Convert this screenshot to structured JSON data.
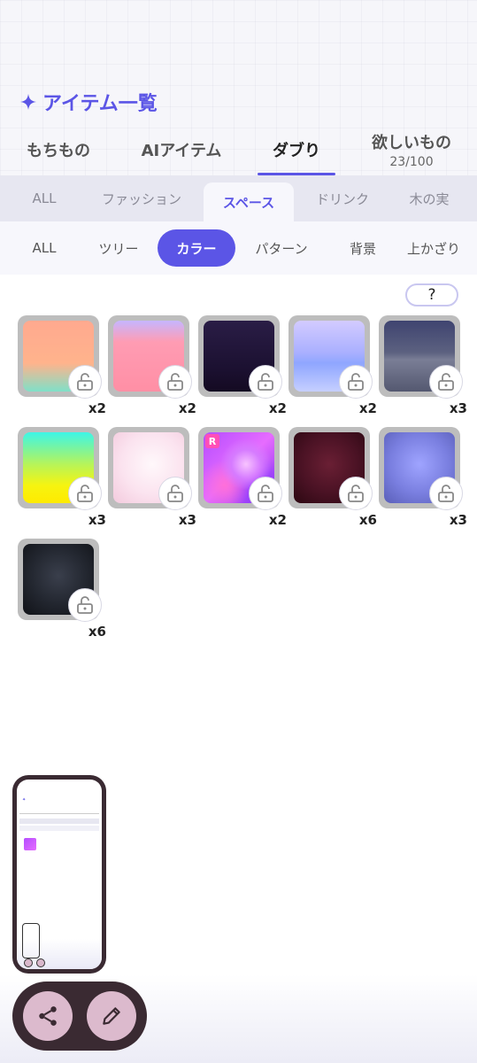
{
  "title": {
    "icon": "sparkle-icon",
    "text": "アイテム一覧"
  },
  "main_tabs": [
    {
      "label": "もちもの",
      "sub": ""
    },
    {
      "label": "AIアイテム",
      "sub": ""
    },
    {
      "label": "ダブり",
      "sub": ""
    },
    {
      "label": "欲しいもの",
      "sub": "23/100"
    }
  ],
  "main_tabs_active": "ダブり",
  "categories": [
    "ALL",
    "ファッション",
    "スペース",
    "ドリンク",
    "木の実"
  ],
  "categories_active": "スペース",
  "subcategories": [
    "ALL",
    "ツリー",
    "カラー",
    "パターン",
    "背景",
    "上かざり"
  ],
  "subcategories_active": "カラー",
  "help": {
    "label": "?"
  },
  "items": [
    {
      "count": "x2",
      "locked": true,
      "rare": ""
    },
    {
      "count": "x2",
      "locked": true,
      "rare": ""
    },
    {
      "count": "x2",
      "locked": true,
      "rare": ""
    },
    {
      "count": "x2",
      "locked": true,
      "rare": ""
    },
    {
      "count": "x3",
      "locked": true,
      "rare": ""
    },
    {
      "count": "x3",
      "locked": true,
      "rare": ""
    },
    {
      "count": "x3",
      "locked": true,
      "rare": ""
    },
    {
      "count": "x2",
      "locked": true,
      "rare": "R"
    },
    {
      "count": "x6",
      "locked": true,
      "rare": ""
    },
    {
      "count": "x3",
      "locked": true,
      "rare": ""
    },
    {
      "count": "x6",
      "locked": true,
      "rare": ""
    }
  ],
  "actions": {
    "share_icon": "share-icon",
    "edit_icon": "pencil-icon"
  },
  "colors": {
    "accent": "#5b55e6",
    "fab": "#dcbacd",
    "bar": "#3a2a32"
  }
}
